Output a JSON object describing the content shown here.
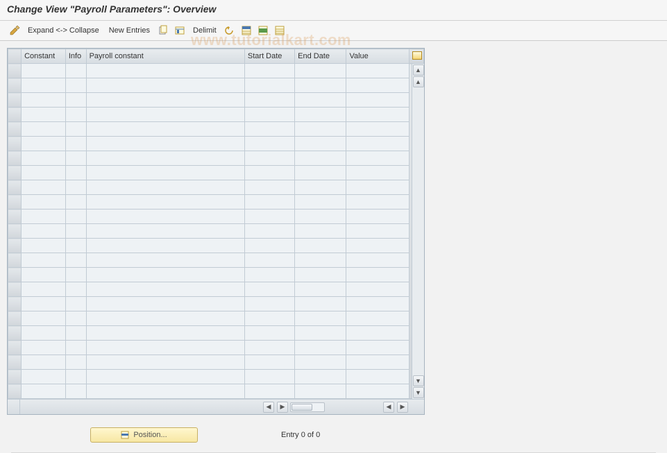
{
  "title": "Change View \"Payroll Parameters\": Overview",
  "toolbar": {
    "toggle_label": "Expand <-> Collapse",
    "new_entries_label": "New Entries",
    "delimit_label": "Delimit",
    "icons": {
      "pencil": "toggle-display-change-icon",
      "copy": "copy-as-icon",
      "delete": "delete-icon",
      "undo": "undo-change-icon",
      "select_all": "select-all-icon",
      "select_block": "select-block-icon",
      "deselect_all": "deselect-all-icon"
    }
  },
  "columns": {
    "constant": "Constant",
    "info": "Info",
    "payroll_constant": "Payroll constant",
    "start_date": "Start Date",
    "end_date": "End Date",
    "value": "Value"
  },
  "rows_visible": 23,
  "footer": {
    "position_label": "Position...",
    "entry_label": "Entry 0 of 0"
  },
  "watermark": "www.tutorialkart.com"
}
